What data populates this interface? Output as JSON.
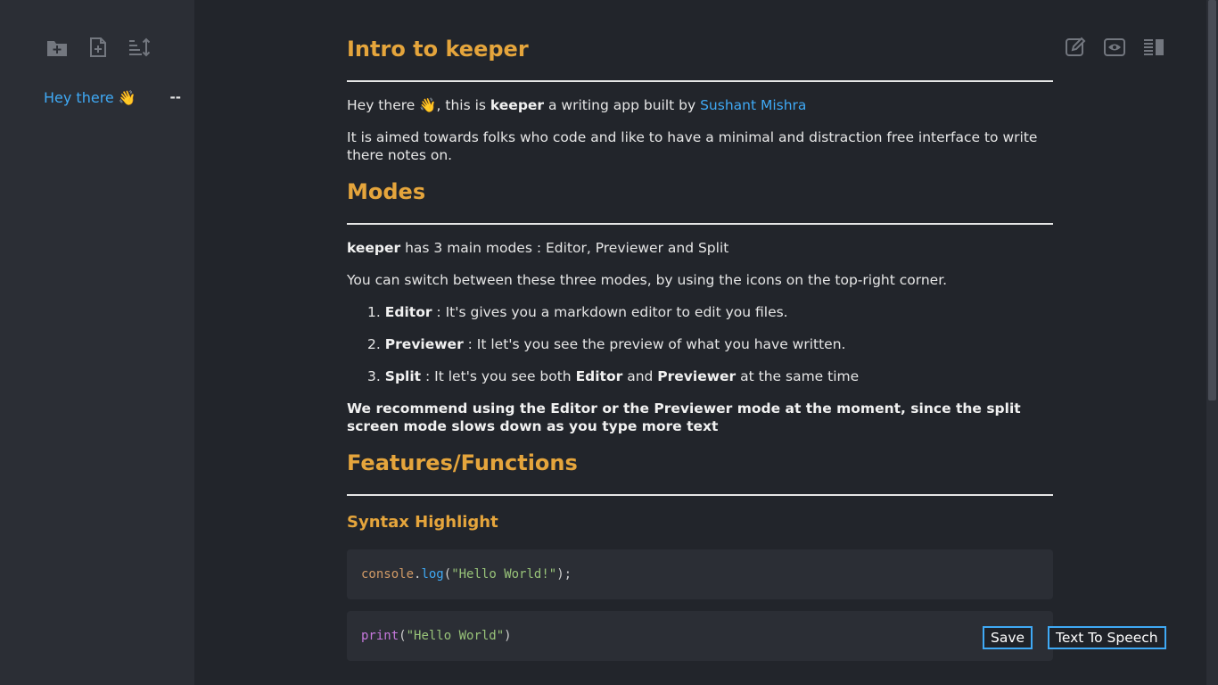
{
  "sidebar": {
    "notes": [
      {
        "title": "Hey there 👋",
        "marker": "--"
      }
    ]
  },
  "doc": {
    "title": "Intro to keeper",
    "intro": {
      "before_bold": "Hey there 👋, this is ",
      "bold": "keeper",
      "middle": " a writing app built by ",
      "link": "Sushant Mishra"
    },
    "aim": "It is aimed towards folks who code and like to have a minimal and distraction free interface to write there notes on.",
    "modes_heading": "Modes",
    "modes_line": {
      "bold": "keeper",
      "rest": " has 3 main modes : Editor, Previewer and Split"
    },
    "switch_line": "You can switch between these three modes, by using the icons on the top-right corner.",
    "modes_list": [
      {
        "num": "1.",
        "name": "Editor",
        "desc": " : It's gives you a markdown editor to edit you files."
      },
      {
        "num": "2.",
        "name": "Previewer",
        "desc": " : It let's you see the preview of what you have written."
      }
    ],
    "split_item": {
      "num": "3.",
      "name": "Split",
      "desc_a": " : It let's you see both ",
      "b1": "Editor",
      "and": " and ",
      "b2": "Previewer",
      "desc_b": " at the same time"
    },
    "recommend": "We recommend using the Editor or the Previewer mode at the moment, since the split screen mode slows down as you type more text",
    "features_heading": "Features/Functions",
    "syntax_heading": "Syntax Highlight",
    "code1": {
      "obj": "console",
      "dot": ".",
      "fn": "log",
      "open": "(",
      "str": "\"Hello World!\"",
      "close": ");"
    },
    "code2": {
      "fn": "print",
      "open": "(",
      "str": "\"Hello World\"",
      "close": ")"
    }
  },
  "actions": {
    "save": "Save",
    "tts": "Text To Speech"
  },
  "icons": {
    "sidebar": [
      "new-folder-icon",
      "new-file-icon",
      "sort-icon"
    ],
    "modes": [
      "editor-mode-icon",
      "preview-mode-icon",
      "split-mode-icon"
    ]
  },
  "colors": {
    "accent": "#3fa9f5",
    "heading": "#e5a53c",
    "background": "#22252b",
    "sidebar": "#2b2e35"
  }
}
